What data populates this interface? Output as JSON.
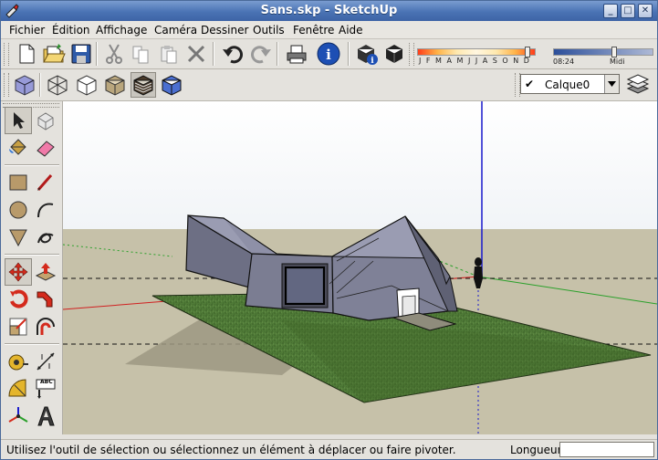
{
  "window": {
    "title": "Sans.skp - SketchUp",
    "minimize": "_",
    "maximize": "□",
    "close": "✕"
  },
  "menu": [
    "Fichier",
    "Édition",
    "Affichage",
    "Caméra",
    "Dessiner",
    "Outils",
    "Fenêtre",
    "Aide"
  ],
  "shadow_bar": {
    "months": "J F M A M J J A S O N D",
    "time_label": "08:24",
    "noon_label": "Midi",
    "date_slider": 0.95,
    "time_slider": 0.62
  },
  "layer": {
    "check": "✔",
    "name": "Calque0"
  },
  "status": {
    "message": "Utilisez l'outil de sélection ou sélectionnez un élément à déplacer ou faire pivoter.",
    "measure_label": "Longueur",
    "measure_value": ""
  },
  "tools": {
    "text_label": "ABC"
  },
  "colors": {
    "sky": "#ffffff",
    "ground": "#c6c1a9",
    "lawn": "#4f7a37",
    "building": "#7b7d92",
    "axis_red": "#d02020",
    "axis_green": "#2aa02a",
    "axis_blue": "#1a1acc",
    "titlebar": "#4a73b4"
  }
}
